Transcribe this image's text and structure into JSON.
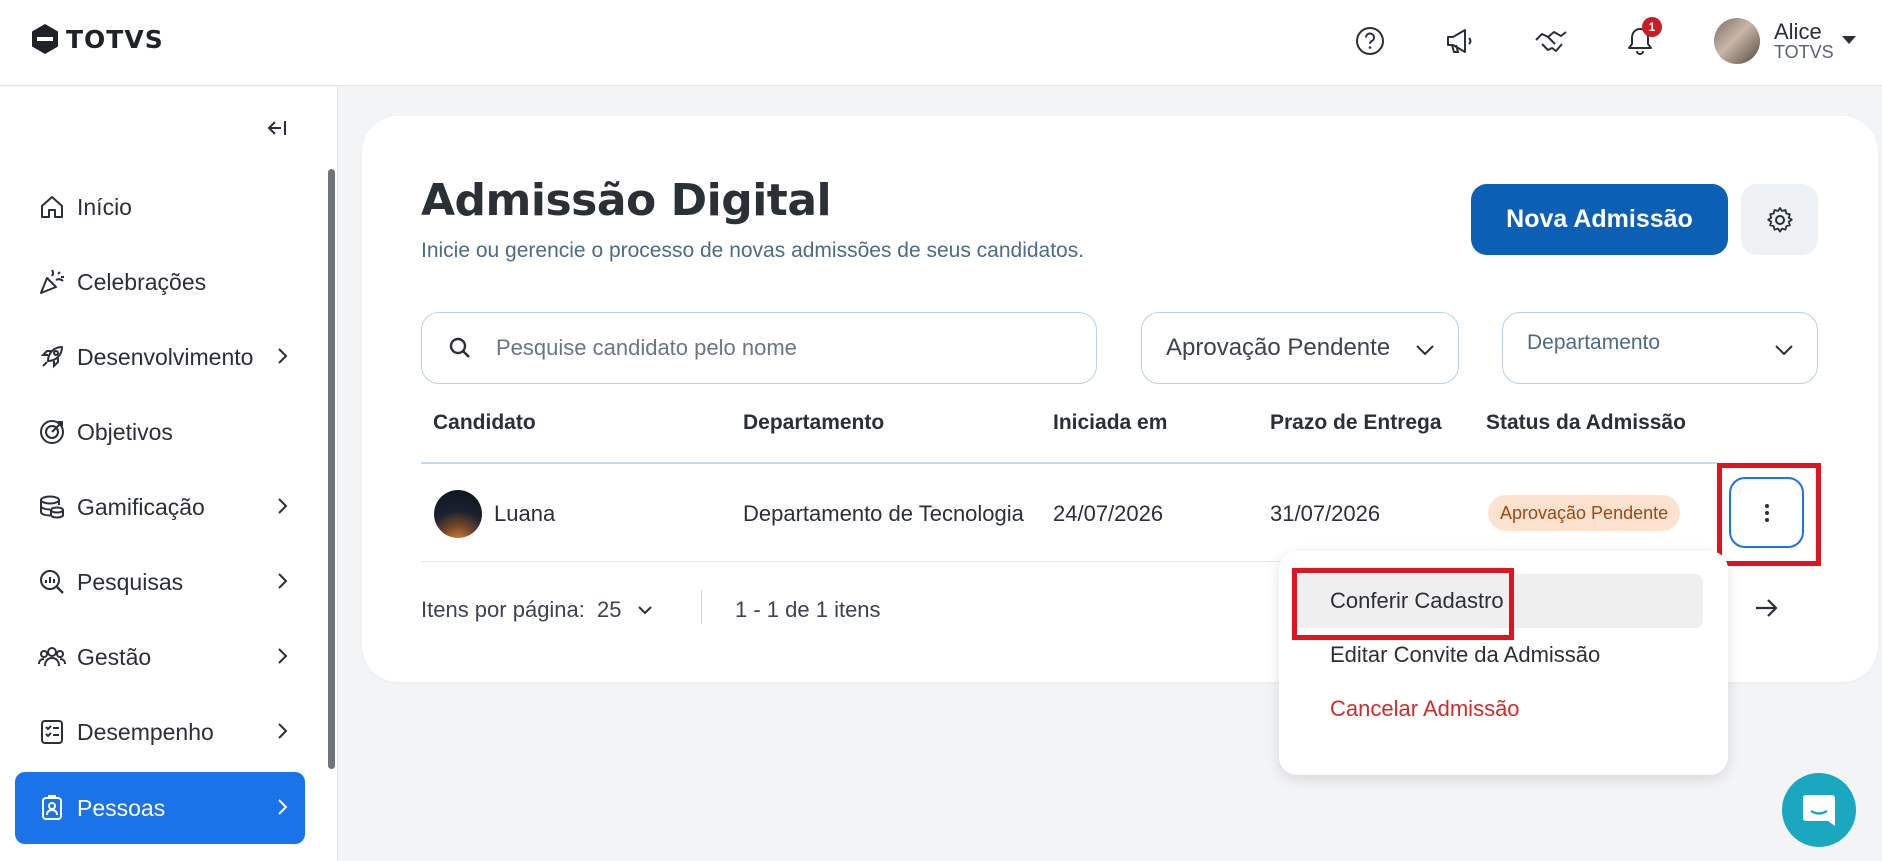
{
  "app": {
    "brand": "TOTVS"
  },
  "header": {
    "notifications_count": "1",
    "user": {
      "name": "Alice",
      "org": "TOTVS"
    }
  },
  "sidebar": {
    "items": [
      {
        "label": "Início",
        "icon": "home-icon",
        "has_children": false
      },
      {
        "label": "Celebrações",
        "icon": "party-popper-icon",
        "has_children": false
      },
      {
        "label": "Desenvolvimento",
        "icon": "rocket-icon",
        "has_children": true
      },
      {
        "label": "Objetivos",
        "icon": "target-icon",
        "has_children": false
      },
      {
        "label": "Gamificação",
        "icon": "coins-icon",
        "has_children": true
      },
      {
        "label": "Pesquisas",
        "icon": "search-chart-icon",
        "has_children": true
      },
      {
        "label": "Gestão",
        "icon": "team-icon",
        "has_children": true
      },
      {
        "label": "Desempenho",
        "icon": "checklist-icon",
        "has_children": true
      },
      {
        "label": "Pessoas",
        "icon": "badge-icon",
        "has_children": true,
        "active": true
      }
    ]
  },
  "page": {
    "title": "Admissão Digital",
    "subtitle": "Inicie ou gerencie o processo de novas admissões de seus candidatos.",
    "new_button": "Nova Admissão"
  },
  "filters": {
    "search_placeholder": "Pesquise candidato pelo nome",
    "status_value": "Aprovação Pendente",
    "department_placeholder": "Departamento"
  },
  "table": {
    "columns": [
      "Candidato",
      "Departamento",
      "Iniciada em",
      "Prazo de Entrega",
      "Status da Admissão"
    ],
    "rows": [
      {
        "candidate": "Luana",
        "department": "Departamento de Tecnologia",
        "started": "24/07/2026",
        "deadline": "31/07/2026",
        "status": "Aprovação Pendente"
      }
    ]
  },
  "pagination": {
    "per_page_label": "Itens por página:",
    "per_page_value": "25",
    "range": "1 - 1 de 1 itens"
  },
  "row_menu": {
    "items": [
      {
        "label": "Conferir Cadastro"
      },
      {
        "label": "Editar Convite da Admissão"
      },
      {
        "label": "Cancelar Admissão"
      }
    ]
  },
  "colors": {
    "primary": "#0b5fb4",
    "active_nav": "#1a73e8",
    "status_badge_bg": "#fde3cf",
    "danger": "#d22b2b",
    "highlight": "#e0141e",
    "chat": "#1aa7c0"
  }
}
